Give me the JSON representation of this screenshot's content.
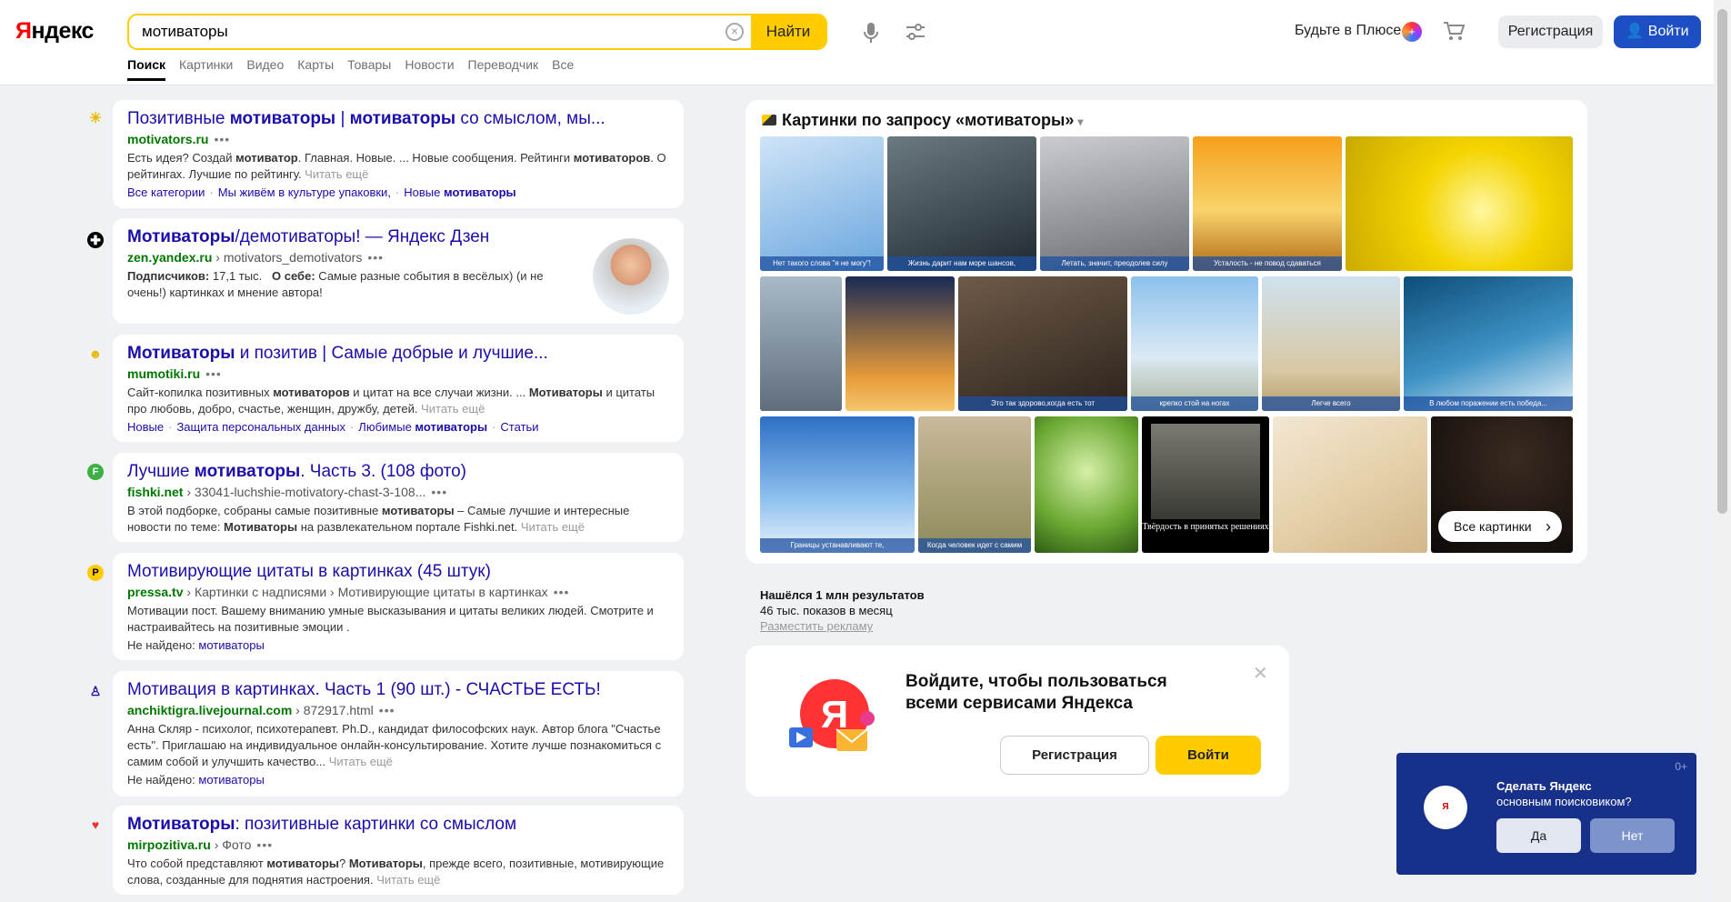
{
  "header": {
    "logo_ya": "Я",
    "logo_rest": "ндекс",
    "search_value": "мотиваторы",
    "find_label": "Найти",
    "plus_label": "Будьте в Плюсе",
    "register_label": "Регистрация",
    "login_label": "Войти",
    "tabs": [
      "Поиск",
      "Картинки",
      "Видео",
      "Карты",
      "Товары",
      "Новости",
      "Переводчик",
      "Все"
    ]
  },
  "results": [
    {
      "title_parts": [
        "Позитивные ",
        "мотиваторы",
        " | ",
        "мотиваторы",
        " со смыслом, мы..."
      ],
      "domain": "motivators.ru",
      "path": "",
      "snippet": "Есть идея? Создай мотиватор. Главная. Новые. ... Новые сообщения. Рейтинги мотиваторов. О рейтингах. Лучшие по рейтингу.",
      "more": "Читать ещё",
      "sitelinks": [
        "Все категории",
        "Мы живём в культуре упаковки,",
        "Новые мотиваторы"
      ]
    },
    {
      "title_parts": [
        "Мотиваторы",
        "/демотиваторы! — Яндекс Дзен"
      ],
      "domain": "zen.yandex.ru",
      "path": "motivators_demotivators",
      "subscribers_label": "Подписчиков:",
      "subscribers_value": "17,1 тыс.",
      "about_label": "О себе:",
      "snippet": "Самые разные события в весёлых) (и не очень!) картинках и мнение автора!"
    },
    {
      "title_parts": [
        "Мотиваторы",
        " и позитив | Самые добрые и лучшие..."
      ],
      "domain": "mumotiki.ru",
      "path": "",
      "snippet": "Сайт-копилка позитивных мотиваторов и цитат на все случаи жизни. ... Мотиваторы и цитаты про любовь, добро, счастье, женщин, дружбу, детей.",
      "more": "Читать ещё",
      "sitelinks": [
        "Новые",
        "Защита персональных данных",
        "Любимые мотиваторы",
        "Статьи"
      ]
    },
    {
      "title_parts": [
        "Лучшие ",
        "мотиваторы",
        ". Часть 3. (108 фото)"
      ],
      "domain": "fishki.net",
      "path": "33041-luchshie-motivatory-chast-3-108...",
      "snippet": "В этой подборке, собраны самые позитивные мотиваторы – Самые лучшие и интересные новости по теме: Мотиваторы на развлекательном портале Fishki.net.",
      "more": "Читать ещё"
    },
    {
      "title_parts": [
        "Мотивирующие цитаты в картинках (45 штук)"
      ],
      "domain": "pressa.tv",
      "path": "Картинки с надписями › Мотивирующие цитаты в картинках",
      "snippet": "Мотивации пост. Вашему вниманию умные высказывания и цитаты великих людей. Смотрите и настраивайтесь на позитивные эмоции .",
      "not_found_label": "Не найдено:",
      "not_found_word": "мотиваторы"
    },
    {
      "title_parts": [
        "Мотивация в картинках. Часть 1 (90 шт.) - СЧАСТЬЕ ЕСТЬ!"
      ],
      "domain": "anchiktigra.livejournal.com",
      "path": "872917.html",
      "snippet": "Анна Скляр - психолог, психотерапевт. Ph.D., кандидат философских наук. Автор блога \"Счастье есть\". Приглашаю на индивидуальное онлайн-консультирование. Хотите лучше познакомиться с самим собой и улучшить качество...",
      "more": "Читать ещё",
      "not_found_label": "Не найдено:",
      "not_found_word": "мотиваторы"
    },
    {
      "title_parts": [
        "Мотиваторы",
        ": позитивные картинки со смыслом"
      ],
      "domain": "mirpozitiva.ru",
      "path": "Фото",
      "snippet": "Что собой представляют мотиваторы? Мотиваторы, прежде всего, позитивные, мотивирующие слова, созданные для поднятия настроения.",
      "more": "Читать ещё"
    }
  ],
  "images": {
    "title": "Картинки по запросу «мотиваторы»",
    "captions": [
      "Нет такого слова \"я не могу\"!",
      "Жизнь дарит нам море шансов,",
      "Летать, значит, преодолев силу",
      "Усталость - не повод сдаваться",
      "",
      "",
      "",
      "Это так здорово,когда есть тот",
      "крепко стой на ногах",
      "Легче всего",
      "В любом поражении есть победа...",
      "Границы устанавливают те,",
      "Когда человек идет с самим",
      "",
      "Твёрдость в принятых решениях",
      "",
      ""
    ],
    "all_label": "Все картинки"
  },
  "stats": {
    "found": "Нашёлся 1 млн результатов",
    "shows": "46 тыс. показов в месяц",
    "ad": "Разместить рекламу"
  },
  "login_card": {
    "text": "Войдите, чтобы пользоваться всеми сервисами Яндекса",
    "register": "Регистрация",
    "login": "Войти"
  },
  "popup": {
    "count": "0+",
    "line1": "Сделать Яндекс",
    "line2": "основным поисковиком?",
    "yes": "Да",
    "no": "Нет"
  },
  "colors": {
    "accent_yellow": "#ffcc00",
    "link_blue": "#1a0dab",
    "url_green": "#007700",
    "login_blue": "#1c4ec4",
    "popup_blue": "#17308a"
  }
}
